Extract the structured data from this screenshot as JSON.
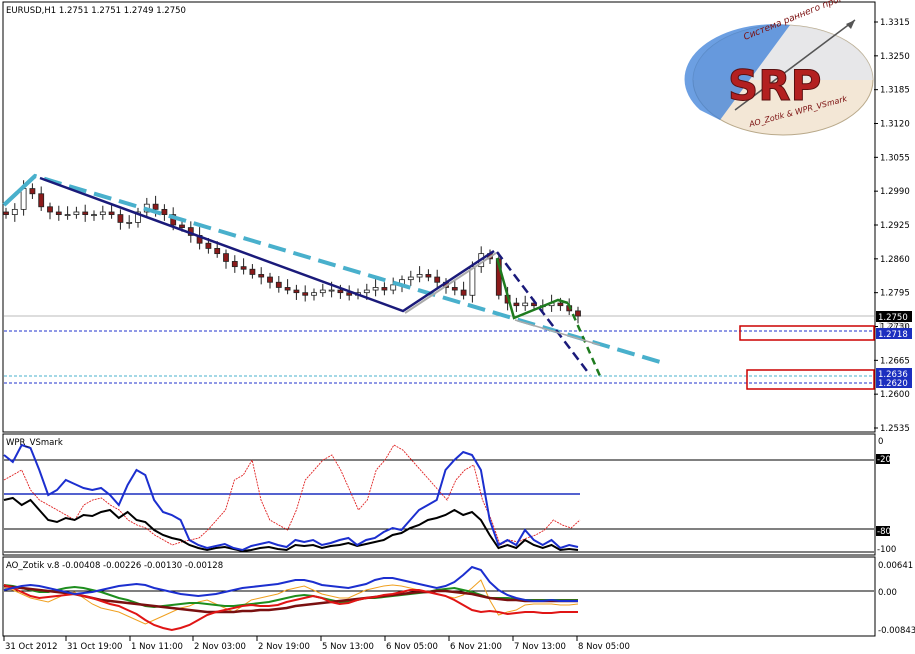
{
  "main": {
    "title": "EURUSD,H1  1.2751 1.2751 1.2749 1.2750",
    "price_ticks": [
      "1.3315",
      "1.3250",
      "1.3185",
      "1.3120",
      "1.3055",
      "1.2990",
      "1.2925",
      "1.2860",
      "1.2795",
      "1.2730",
      "1.2665",
      "1.2600",
      "1.2535"
    ],
    "current_price": "1.2750",
    "level_1": "1.2718",
    "level_2": "1.2636",
    "level_3": "1.2620",
    "hidden_price": "1.2730"
  },
  "logo": {
    "arc_top": "Система раннего прогнозирования",
    "letters": "SRP",
    "arc_bottom": "AO_Zotik & WPR_VSmark"
  },
  "wpr": {
    "title": "WPR_VSmark",
    "ticks": [
      "0",
      "-20",
      "-80",
      "-100"
    ]
  },
  "ao": {
    "title": "AO_Zotik v.8 -0.00408 -0.00226 -0.00130 -0.00128",
    "ticks": [
      "0.00641",
      "0.00",
      "-0.00843"
    ]
  },
  "x_axis": {
    "labels": [
      "31 Oct 2012",
      "31 Oct 19:00",
      "1 Nov 11:00",
      "2 Nov 03:00",
      "2 Nov 19:00",
      "5 Nov 13:00",
      "6 Nov 05:00",
      "6 Nov 21:00",
      "7 Nov 13:00",
      "8 Nov 05:00"
    ]
  },
  "colors": {
    "bull": "#ffffff",
    "bear": "#8b1a1a",
    "wick": "#222222",
    "navy": "#1a1a7a",
    "dashed_cyan": "#49b0cc",
    "green": "#1e7b1e",
    "level_line": "#2233cc",
    "box": "#cc0000"
  },
  "chart_data": {
    "type": "line",
    "symbol": "EURUSD,H1",
    "ohlc": {
      "open": 1.2751,
      "high": 1.2751,
      "low": 1.2749,
      "close": 1.275
    },
    "ylim": [
      1.2535,
      1.3315
    ],
    "close_series": [
      1.2945,
      1.2955,
      1.2995,
      1.2985,
      1.296,
      1.295,
      1.2945,
      1.2945,
      1.295,
      1.2945,
      1.2945,
      1.295,
      1.2945,
      1.293,
      1.293,
      1.295,
      1.2965,
      1.2955,
      1.2945,
      1.2925,
      1.292,
      1.2905,
      1.289,
      1.288,
      1.287,
      1.2855,
      1.2845,
      1.284,
      1.283,
      1.2825,
      1.2815,
      1.2805,
      1.28,
      1.2795,
      1.279,
      1.2795,
      1.28,
      1.28,
      1.2795,
      1.279,
      1.2795,
      1.28,
      1.2805,
      1.28,
      1.281,
      1.282,
      1.2825,
      1.283,
      1.2825,
      1.2815,
      1.2805,
      1.28,
      1.279,
      1.2845,
      1.287,
      1.286,
      1.279,
      1.2775,
      1.277,
      1.2775,
      1.277,
      1.277,
      1.2775,
      1.277,
      1.276,
      1.275
    ],
    "levels": [
      1.2718,
      1.2636,
      1.262
    ],
    "trendlines": [
      {
        "name": "navy_down_1",
        "points": [
          [
            1.299,
            1.3005
          ],
          [
            1.2955,
            1.2965
          ],
          [
            1.2875,
            1.277
          ]
        ]
      },
      {
        "name": "navy_up",
        "points": [
          [
            1.277,
            1.277
          ],
          [
            1.287,
            1.287
          ]
        ]
      }
    ],
    "wpr_levels": [
      -20,
      -80,
      -100
    ],
    "wpr_mid": -50,
    "ao_values": {
      "a": -0.00408,
      "b": -0.00226,
      "c": -0.0013,
      "d": -0.00128
    },
    "ao_range": [
      -0.00843,
      0.00641
    ]
  }
}
